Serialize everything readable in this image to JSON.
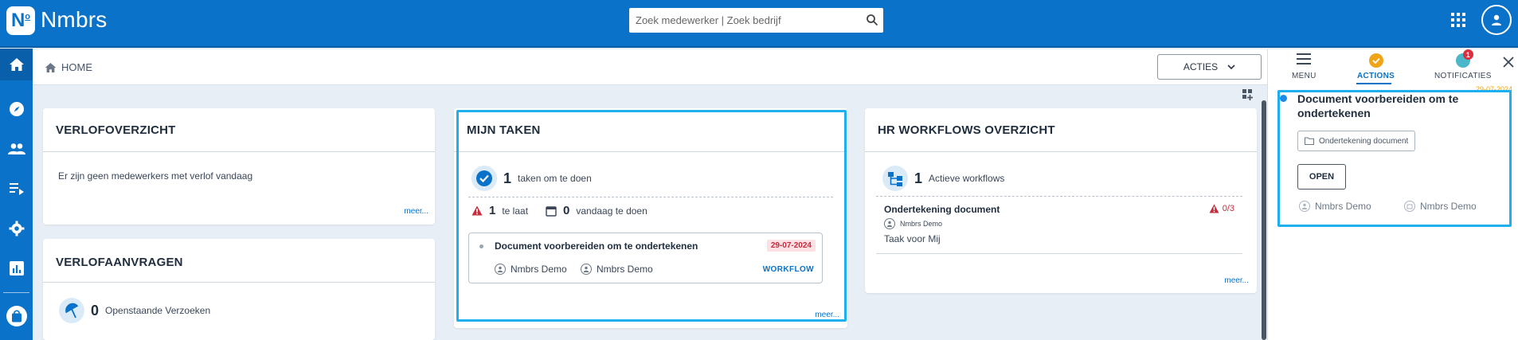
{
  "app": {
    "brand": "Nmbrs",
    "logo_letter": "N",
    "logo_sup": "o"
  },
  "search": {
    "placeholder": "Zoek medewerker | Zoek bedrijf"
  },
  "breadcrumb": {
    "label": "HOME"
  },
  "toolbar": {
    "acties_label": "ACTIES"
  },
  "colors": {
    "primary": "#0a72c9",
    "highlight": "#1eb0ee",
    "danger": "#c62c3c",
    "warning": "#f1a516"
  },
  "leftnav": {
    "icons": [
      "home-icon",
      "compass-icon",
      "people-icon",
      "list-icon",
      "gear-icon",
      "bar-chart-icon",
      "shopping-bag-icon"
    ]
  },
  "verlofoverzicht": {
    "title": "VERLOFOVERZICHT",
    "empty_text": "Er zijn geen medewerkers met verlof vandaag",
    "meer": "meer..."
  },
  "verlofaanvragen": {
    "title": "VERLOFAANVRAGEN",
    "count": "0",
    "count_label": "Openstaande Verzoeken"
  },
  "mijn_taken": {
    "title": "MIJN TAKEN",
    "todo_count": "1",
    "todo_label": "taken om te doen",
    "late_count": "1",
    "late_label": "te laat",
    "today_count": "0",
    "today_label": "vandaag te doen",
    "task": {
      "title": "Document voorbereiden om te ondertekenen",
      "date": "29-07-2024",
      "assignee_1": "Nmbrs Demo",
      "assignee_2": "Nmbrs Demo",
      "tag": "WORKFLOW"
    },
    "meer": "meer..."
  },
  "hr_workflows": {
    "title": "HR WORKFLOWS OVERZICHT",
    "count": "1",
    "count_label": "Actieve workflows",
    "item": {
      "title": "Ondertekening document",
      "person": "Nmbrs Demo",
      "subtitle": "Taak voor Mij",
      "progress": "0/3"
    },
    "meer": "meer..."
  },
  "right_panel": {
    "tabs": {
      "menu": "MENU",
      "actions": "ACTIONS",
      "notificaties": "NOTIFICATIES",
      "notification_badge": "1"
    },
    "date": "29-07-2024",
    "action": {
      "title": "Document voorbereiden om te ondertekenen",
      "chip": "Ondertekening document",
      "open_label": "OPEN",
      "person_1": "Nmbrs Demo",
      "person_2": "Nmbrs Demo"
    }
  }
}
